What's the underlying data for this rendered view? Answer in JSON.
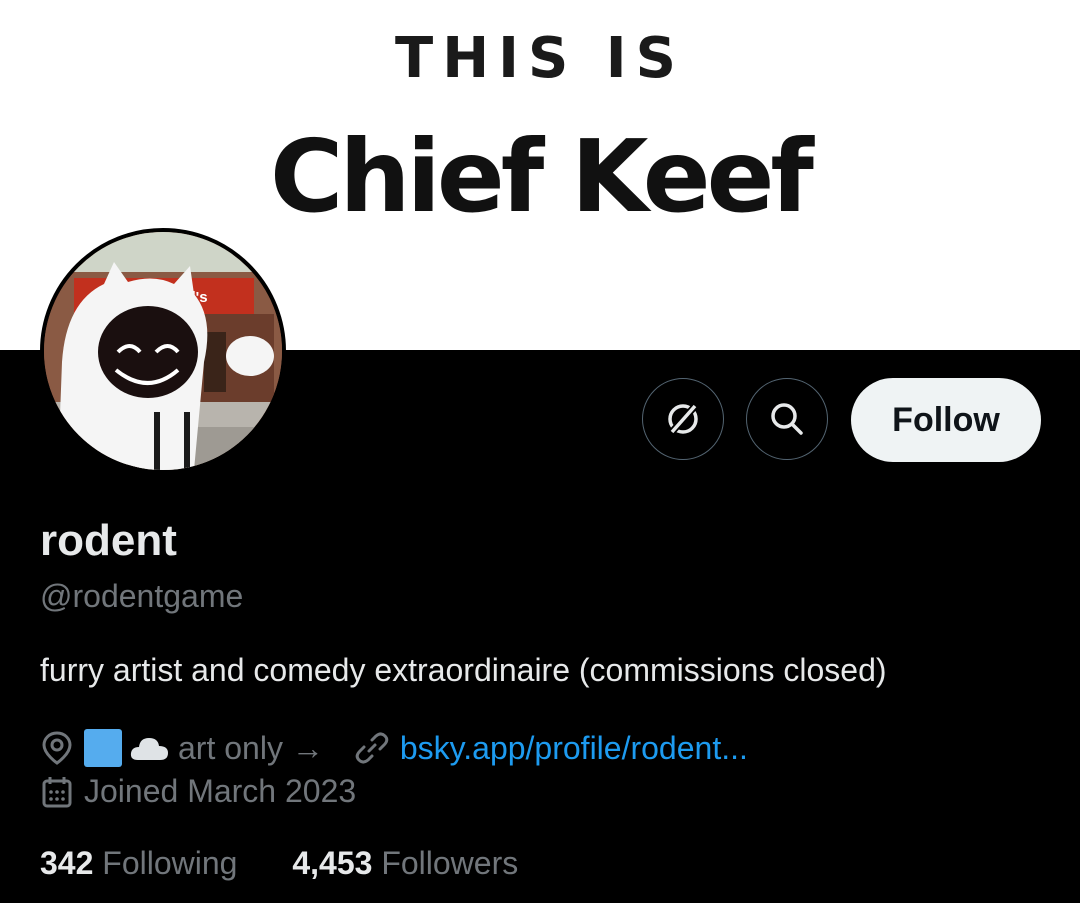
{
  "banner": {
    "line1": "THIS IS",
    "line2": "Chief Keef"
  },
  "avatar": {
    "sign_text": "McDonald's"
  },
  "actions": {
    "follow_label": "Follow",
    "icons": [
      "grok-icon",
      "search-icon"
    ]
  },
  "profile": {
    "display_name": "rodent",
    "handle": "@rodentgame",
    "bio": "furry artist and comedy extraordinaire (commissions closed)",
    "location": "art only →",
    "link": "bsky.app/profile/rodent...",
    "joined": "Joined March 2023"
  },
  "stats": {
    "following_count": "342",
    "following_label": "Following",
    "followers_count": "4,453",
    "followers_label": "Followers"
  },
  "colors": {
    "background": "#000000",
    "link": "#1d9bf0",
    "muted": "#71767b",
    "text": "#e7e9ea",
    "follow_bg": "#eff3f4"
  }
}
